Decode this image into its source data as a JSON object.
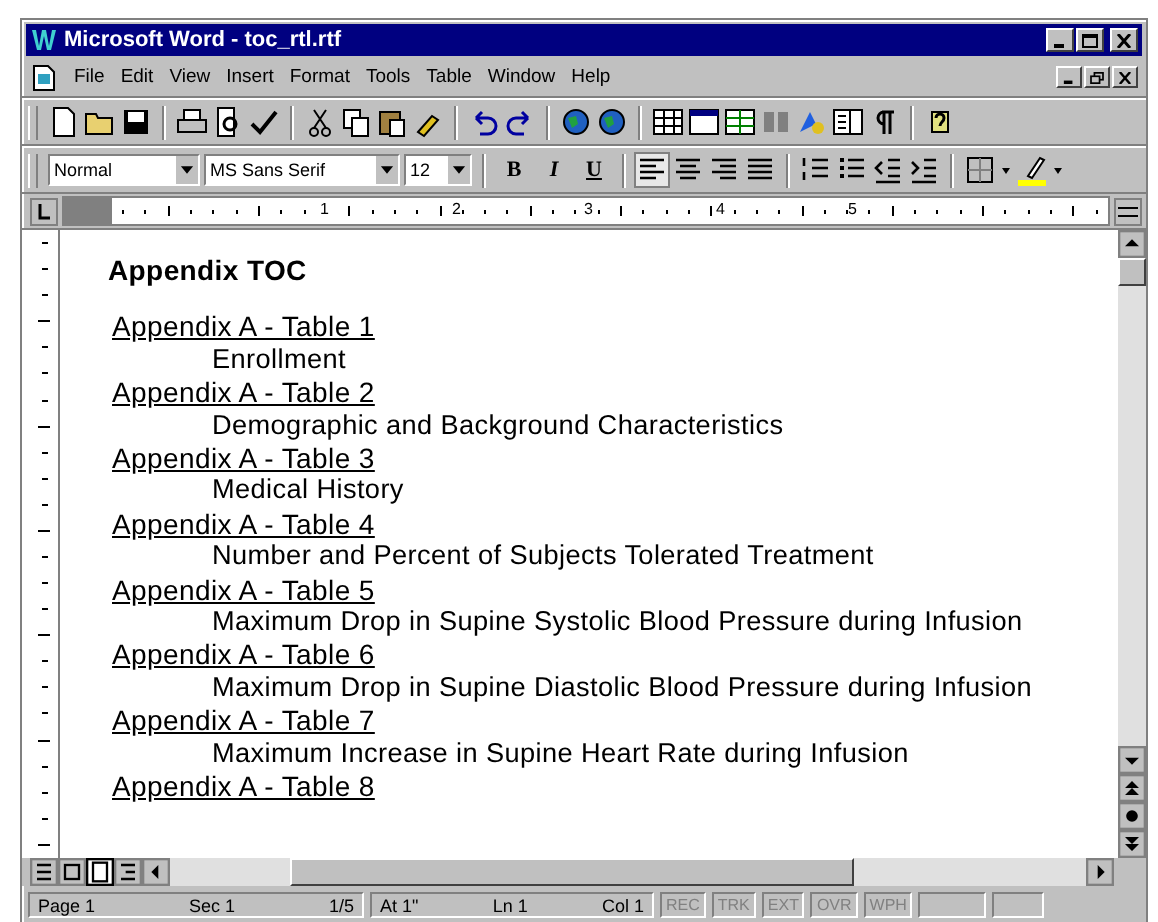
{
  "window": {
    "title": "Microsoft Word - toc_rtl.rtf"
  },
  "menu": [
    "File",
    "Edit",
    "View",
    "Insert",
    "Format",
    "Tools",
    "Table",
    "Window",
    "Help"
  ],
  "format_toolbar": {
    "style": "Normal",
    "font": "MS Sans Serif",
    "size": "12",
    "text_buttons": [
      {
        "label": "B",
        "kind": "bold"
      },
      {
        "label": "I",
        "kind": "italic"
      },
      {
        "label": "U",
        "kind": "underline"
      }
    ],
    "alignment": [
      {
        "kind": "left",
        "selected": true
      },
      {
        "kind": "center",
        "selected": false
      },
      {
        "kind": "right",
        "selected": false
      },
      {
        "kind": "justify",
        "selected": false
      }
    ]
  },
  "ruler": {
    "labels": [
      "1",
      "2",
      "3",
      "4",
      "5"
    ]
  },
  "document": {
    "heading": "Appendix TOC",
    "entries": [
      {
        "link": "Appendix A - Table 1",
        "title": "Enrollment"
      },
      {
        "link": "Appendix A - Table 2",
        "title": "Demographic and Background Characteristics"
      },
      {
        "link": "Appendix A - Table 3",
        "title": "Medical History"
      },
      {
        "link": "Appendix A - Table 4",
        "title": "Number and Percent of Subjects Tolerated Treatment"
      },
      {
        "link": "Appendix A - Table 5",
        "title": "Maximum Drop in Supine Systolic Blood Pressure during Infusion"
      },
      {
        "link": "Appendix A - Table 6",
        "title": "Maximum Drop in Supine Diastolic Blood Pressure during Infusion"
      },
      {
        "link": "Appendix A - Table 7",
        "title": "Maximum Increase in Supine Heart Rate during Infusion"
      },
      {
        "link": "Appendix A - Table 8"
      }
    ]
  },
  "status_bar": {
    "fields": [
      {
        "text": "Page 1"
      },
      {
        "text": "Sec 1"
      },
      {
        "text": "1/5"
      },
      {
        "text": "At 1\""
      },
      {
        "text": "Ln 1"
      },
      {
        "text": "Col 1"
      }
    ],
    "modes": [
      {
        "text": "REC",
        "disabled": true
      },
      {
        "text": "TRK",
        "disabled": true
      },
      {
        "text": "EXT",
        "disabled": true
      },
      {
        "text": "OVR",
        "disabled": true
      },
      {
        "text": "WPH",
        "disabled": true
      }
    ]
  }
}
